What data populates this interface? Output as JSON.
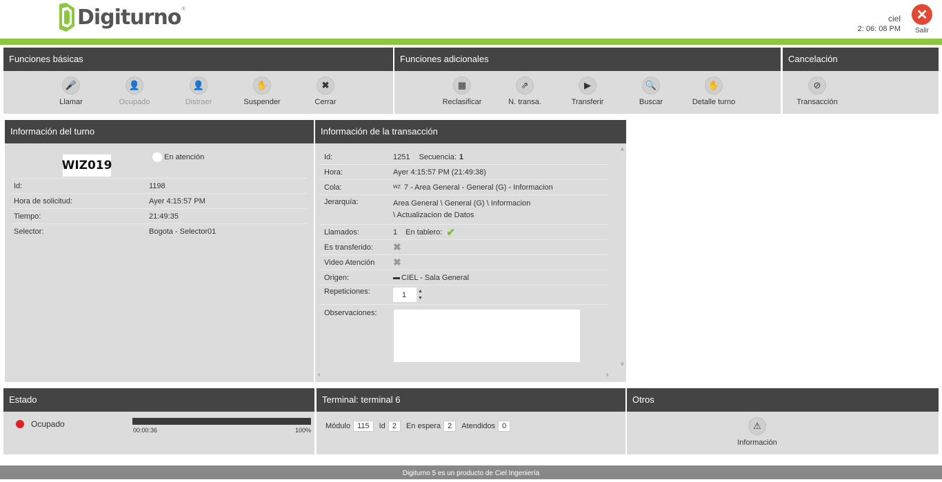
{
  "app": {
    "brand": "Digiturno",
    "brand_mark": "®",
    "user": "ciel",
    "time": "2: 06: 08 PM",
    "exit_label": "Salir",
    "footer": "Digiturno 5 es un producto de Ciel Ingeniería"
  },
  "basic": {
    "title": "Funciones básicas",
    "items": [
      {
        "label": "Llamar",
        "icon": "microphone-icon"
      },
      {
        "label": "Ocupado",
        "icon": "person-busy-icon"
      },
      {
        "label": "Distraer",
        "icon": "person-icon"
      },
      {
        "label": "Suspender",
        "icon": "pause-icon"
      },
      {
        "label": "Cerrar",
        "icon": "close-icon"
      }
    ]
  },
  "additional": {
    "title": "Funciones adicionales",
    "items": [
      {
        "label": "Reclasificar",
        "icon": "reclassify-icon"
      },
      {
        "label": "N. transa.",
        "icon": "new-transaction-icon"
      },
      {
        "label": "Transferir",
        "icon": "transfer-icon"
      },
      {
        "label": "Buscar",
        "icon": "search-icon"
      },
      {
        "label": "Detalle turno",
        "icon": "detail-icon"
      }
    ]
  },
  "cancel": {
    "title": "Cancelación",
    "items": [
      {
        "label": "Transacción",
        "icon": "cancel-transaction-icon"
      }
    ]
  },
  "turn": {
    "title": "Información del turno",
    "ticket": "WIZ019",
    "status": "En atención",
    "rows": [
      {
        "k": "Id:",
        "v": "1198"
      },
      {
        "k": "Hora de solicitud:",
        "v": "Ayer 4:15:57 PM"
      },
      {
        "k": "Tiempo:",
        "v": "21:49:35"
      },
      {
        "k": "Selector:",
        "v": "Bogota - Selector01"
      }
    ]
  },
  "transaction": {
    "title": "Información de la transacción",
    "id_label": "Id:",
    "id_value": "1251",
    "seq_label": "Secuencia:",
    "seq_value": "1",
    "hora_label": "Hora:",
    "hora_value": "Ayer 4:15:57 PM (21:49:38)",
    "cola_label": "Cola:",
    "cola_prefix": "WZ",
    "cola_value": "7 - Area General - General (G) - Informacion",
    "jer_label": "Jerarquía:",
    "jer_line1": "Area General \\ General (G) \\ Informacion",
    "jer_line2": "\\ Actualizacion de Datos",
    "llamados_label": "Llamados:",
    "llamados_value": "1",
    "tablero_label": "En tablero:",
    "transferido_label": "Es transferido:",
    "video_label": "Video Atención",
    "origen_label": "Origen:",
    "origen_value": "CIEL - Sala General",
    "repeticiones_label": "Repeticiones:",
    "repeticiones_value": "1",
    "observaciones_label": "Observaciones:"
  },
  "estado": {
    "title": "Estado",
    "status": "Ocupado",
    "elapsed": "00:00:36",
    "percent_label": "100%",
    "progress": 1.0,
    "dot_color": "#e02020"
  },
  "terminal": {
    "title": "Terminal: terminal 6",
    "modulo_label": "Módulo",
    "modulo_value": "115",
    "id_label": "Id",
    "id_value": "2",
    "espera_label": "En espera",
    "espera_value": "2",
    "atendidos_label": "Atendidos",
    "atendidos_value": "0"
  },
  "otros": {
    "title": "Otros",
    "info_label": "Información"
  }
}
